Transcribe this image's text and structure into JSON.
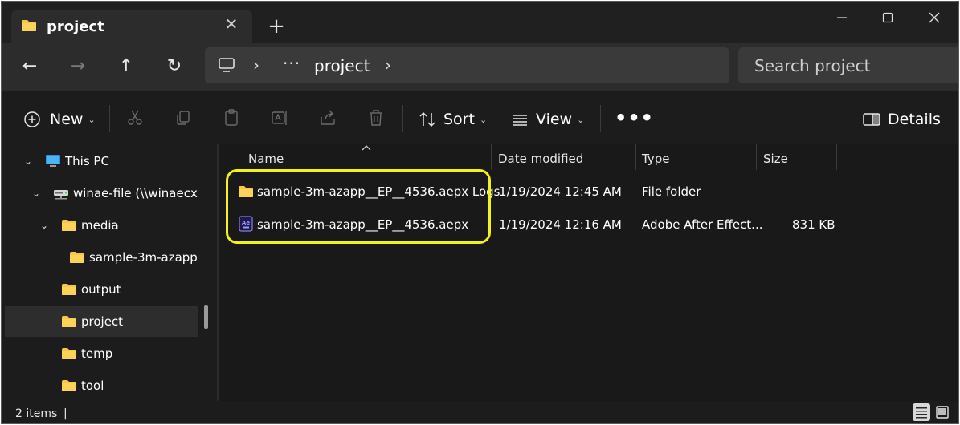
{
  "colors": {
    "window_bg": "#1c1c1c",
    "folder_yellow": "#f8c845",
    "highlight_yellow": "#f3f01a",
    "ae_icon": "#1d1a4b"
  },
  "tab": {
    "title": "project",
    "icon": "folder-icon",
    "close": "✕"
  },
  "new_tab": "+",
  "window_controls": {
    "minimize": "—",
    "maximize": "☐",
    "close": "✕"
  },
  "nav": {
    "back": "←",
    "forward": "→",
    "up": "↑",
    "refresh": "↻"
  },
  "address": {
    "chevron": "›",
    "more": "···",
    "crumb": "project"
  },
  "search": {
    "placeholder": "Search project"
  },
  "toolbar": {
    "new_label": "New",
    "sort_label": "Sort",
    "view_label": "View",
    "more": "•••",
    "details_label": "Details",
    "caret": "⌄"
  },
  "tree": [
    {
      "label": "This PC",
      "expanded": true
    },
    {
      "label": "winae-file (\\\\winaecxwu",
      "expanded": true
    },
    {
      "label": "media",
      "expanded": true
    },
    {
      "label": "sample-3m-azapp"
    },
    {
      "label": "output"
    },
    {
      "label": "project",
      "selected": true
    },
    {
      "label": "temp"
    },
    {
      "label": "tool"
    }
  ],
  "columns": {
    "name": "Name",
    "date": "Date modified",
    "type": "Type",
    "size": "Size"
  },
  "files": [
    {
      "name": "sample-3m-azapp__EP__4536.aepx Logs",
      "date": "1/19/2024 12:45 AM",
      "type": "File folder",
      "size": "",
      "icon": "folder-icon"
    },
    {
      "name": "sample-3m-azapp__EP__4536.aepx",
      "date": "1/19/2024 12:16 AM",
      "type": "Adobe After Effect...",
      "size": "831 KB",
      "icon": "after-effects-icon"
    }
  ],
  "status": {
    "items": "2 items",
    "sep": "|"
  }
}
